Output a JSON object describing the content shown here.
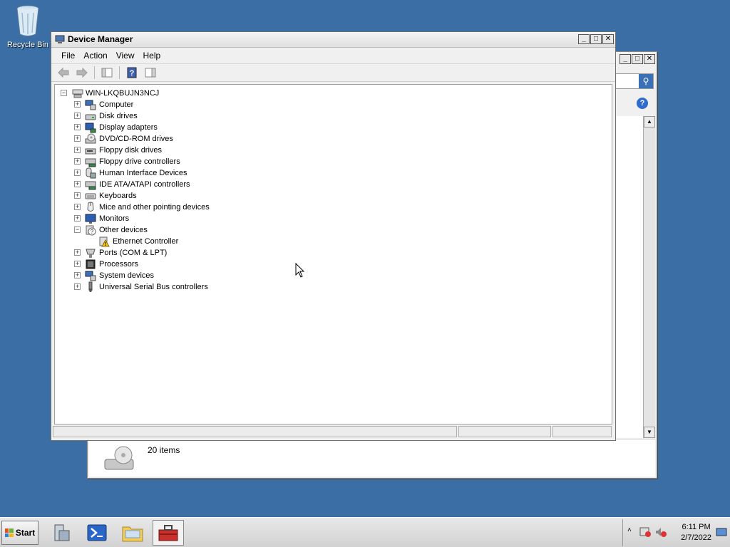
{
  "desktop": {
    "recycle_bin_label": "Recycle Bin"
  },
  "background_window": {
    "status_count": "20 items"
  },
  "window": {
    "title": "Device Manager",
    "menu": [
      "File",
      "Action",
      "View",
      "Help"
    ]
  },
  "tree": {
    "root": "WIN-LKQBUJN3NCJ",
    "items": [
      {
        "label": "Computer",
        "icon": "computer-icon",
        "expanded": false
      },
      {
        "label": "Disk drives",
        "icon": "disk-drive-icon",
        "expanded": false
      },
      {
        "label": "Display adapters",
        "icon": "display-adapter-icon",
        "expanded": false
      },
      {
        "label": "DVD/CD-ROM drives",
        "icon": "dvd-drive-icon",
        "expanded": false
      },
      {
        "label": "Floppy disk drives",
        "icon": "floppy-drive-icon",
        "expanded": false
      },
      {
        "label": "Floppy drive controllers",
        "icon": "floppy-controller-icon",
        "expanded": false
      },
      {
        "label": "Human Interface Devices",
        "icon": "hid-icon",
        "expanded": false
      },
      {
        "label": "IDE ATA/ATAPI controllers",
        "icon": "ide-controller-icon",
        "expanded": false
      },
      {
        "label": "Keyboards",
        "icon": "keyboard-icon",
        "expanded": false
      },
      {
        "label": "Mice and other pointing devices",
        "icon": "mouse-icon",
        "expanded": false
      },
      {
        "label": "Monitors",
        "icon": "monitor-icon",
        "expanded": false
      },
      {
        "label": "Other devices",
        "icon": "other-devices-icon",
        "expanded": true
      },
      {
        "label": "Ethernet Controller",
        "icon": "warning-device-icon",
        "child": true
      },
      {
        "label": "Ports (COM & LPT)",
        "icon": "port-icon",
        "expanded": false
      },
      {
        "label": "Processors",
        "icon": "processor-icon",
        "expanded": false
      },
      {
        "label": "System devices",
        "icon": "system-devices-icon",
        "expanded": false
      },
      {
        "label": "Universal Serial Bus controllers",
        "icon": "usb-icon",
        "expanded": false
      }
    ]
  },
  "taskbar": {
    "start_label": "Start",
    "clock_time": "6:11 PM",
    "clock_date": "2/7/2022"
  }
}
